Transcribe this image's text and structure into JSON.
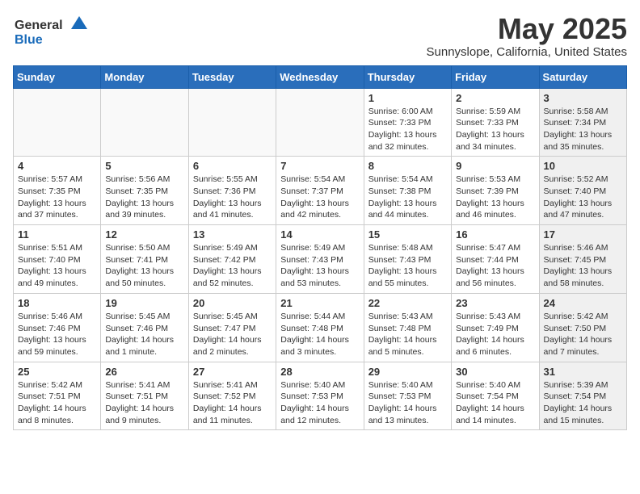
{
  "header": {
    "logo_general": "General",
    "logo_blue": "Blue",
    "month_year": "May 2025",
    "location": "Sunnyslope, California, United States"
  },
  "weekdays": [
    "Sunday",
    "Monday",
    "Tuesday",
    "Wednesday",
    "Thursday",
    "Friday",
    "Saturday"
  ],
  "weeks": [
    [
      {
        "day": "",
        "sunrise": "",
        "sunset": "",
        "daylight": "",
        "empty": true
      },
      {
        "day": "",
        "sunrise": "",
        "sunset": "",
        "daylight": "",
        "empty": true
      },
      {
        "day": "",
        "sunrise": "",
        "sunset": "",
        "daylight": "",
        "empty": true
      },
      {
        "day": "",
        "sunrise": "",
        "sunset": "",
        "daylight": "",
        "empty": true
      },
      {
        "day": "1",
        "sunrise": "Sunrise: 6:00 AM",
        "sunset": "Sunset: 7:33 PM",
        "daylight": "Daylight: 13 hours and 32 minutes."
      },
      {
        "day": "2",
        "sunrise": "Sunrise: 5:59 AM",
        "sunset": "Sunset: 7:33 PM",
        "daylight": "Daylight: 13 hours and 34 minutes."
      },
      {
        "day": "3",
        "sunrise": "Sunrise: 5:58 AM",
        "sunset": "Sunset: 7:34 PM",
        "daylight": "Daylight: 13 hours and 35 minutes.",
        "shaded": true
      }
    ],
    [
      {
        "day": "4",
        "sunrise": "Sunrise: 5:57 AM",
        "sunset": "Sunset: 7:35 PM",
        "daylight": "Daylight: 13 hours and 37 minutes."
      },
      {
        "day": "5",
        "sunrise": "Sunrise: 5:56 AM",
        "sunset": "Sunset: 7:35 PM",
        "daylight": "Daylight: 13 hours and 39 minutes."
      },
      {
        "day": "6",
        "sunrise": "Sunrise: 5:55 AM",
        "sunset": "Sunset: 7:36 PM",
        "daylight": "Daylight: 13 hours and 41 minutes."
      },
      {
        "day": "7",
        "sunrise": "Sunrise: 5:54 AM",
        "sunset": "Sunset: 7:37 PM",
        "daylight": "Daylight: 13 hours and 42 minutes."
      },
      {
        "day": "8",
        "sunrise": "Sunrise: 5:54 AM",
        "sunset": "Sunset: 7:38 PM",
        "daylight": "Daylight: 13 hours and 44 minutes."
      },
      {
        "day": "9",
        "sunrise": "Sunrise: 5:53 AM",
        "sunset": "Sunset: 7:39 PM",
        "daylight": "Daylight: 13 hours and 46 minutes."
      },
      {
        "day": "10",
        "sunrise": "Sunrise: 5:52 AM",
        "sunset": "Sunset: 7:40 PM",
        "daylight": "Daylight: 13 hours and 47 minutes.",
        "shaded": true
      }
    ],
    [
      {
        "day": "11",
        "sunrise": "Sunrise: 5:51 AM",
        "sunset": "Sunset: 7:40 PM",
        "daylight": "Daylight: 13 hours and 49 minutes."
      },
      {
        "day": "12",
        "sunrise": "Sunrise: 5:50 AM",
        "sunset": "Sunset: 7:41 PM",
        "daylight": "Daylight: 13 hours and 50 minutes."
      },
      {
        "day": "13",
        "sunrise": "Sunrise: 5:49 AM",
        "sunset": "Sunset: 7:42 PM",
        "daylight": "Daylight: 13 hours and 52 minutes."
      },
      {
        "day": "14",
        "sunrise": "Sunrise: 5:49 AM",
        "sunset": "Sunset: 7:43 PM",
        "daylight": "Daylight: 13 hours and 53 minutes."
      },
      {
        "day": "15",
        "sunrise": "Sunrise: 5:48 AM",
        "sunset": "Sunset: 7:43 PM",
        "daylight": "Daylight: 13 hours and 55 minutes."
      },
      {
        "day": "16",
        "sunrise": "Sunrise: 5:47 AM",
        "sunset": "Sunset: 7:44 PM",
        "daylight": "Daylight: 13 hours and 56 minutes."
      },
      {
        "day": "17",
        "sunrise": "Sunrise: 5:46 AM",
        "sunset": "Sunset: 7:45 PM",
        "daylight": "Daylight: 13 hours and 58 minutes.",
        "shaded": true
      }
    ],
    [
      {
        "day": "18",
        "sunrise": "Sunrise: 5:46 AM",
        "sunset": "Sunset: 7:46 PM",
        "daylight": "Daylight: 13 hours and 59 minutes."
      },
      {
        "day": "19",
        "sunrise": "Sunrise: 5:45 AM",
        "sunset": "Sunset: 7:46 PM",
        "daylight": "Daylight: 14 hours and 1 minute."
      },
      {
        "day": "20",
        "sunrise": "Sunrise: 5:45 AM",
        "sunset": "Sunset: 7:47 PM",
        "daylight": "Daylight: 14 hours and 2 minutes."
      },
      {
        "day": "21",
        "sunrise": "Sunrise: 5:44 AM",
        "sunset": "Sunset: 7:48 PM",
        "daylight": "Daylight: 14 hours and 3 minutes."
      },
      {
        "day": "22",
        "sunrise": "Sunrise: 5:43 AM",
        "sunset": "Sunset: 7:48 PM",
        "daylight": "Daylight: 14 hours and 5 minutes."
      },
      {
        "day": "23",
        "sunrise": "Sunrise: 5:43 AM",
        "sunset": "Sunset: 7:49 PM",
        "daylight": "Daylight: 14 hours and 6 minutes."
      },
      {
        "day": "24",
        "sunrise": "Sunrise: 5:42 AM",
        "sunset": "Sunset: 7:50 PM",
        "daylight": "Daylight: 14 hours and 7 minutes.",
        "shaded": true
      }
    ],
    [
      {
        "day": "25",
        "sunrise": "Sunrise: 5:42 AM",
        "sunset": "Sunset: 7:51 PM",
        "daylight": "Daylight: 14 hours and 8 minutes."
      },
      {
        "day": "26",
        "sunrise": "Sunrise: 5:41 AM",
        "sunset": "Sunset: 7:51 PM",
        "daylight": "Daylight: 14 hours and 9 minutes."
      },
      {
        "day": "27",
        "sunrise": "Sunrise: 5:41 AM",
        "sunset": "Sunset: 7:52 PM",
        "daylight": "Daylight: 14 hours and 11 minutes."
      },
      {
        "day": "28",
        "sunrise": "Sunrise: 5:40 AM",
        "sunset": "Sunset: 7:53 PM",
        "daylight": "Daylight: 14 hours and 12 minutes."
      },
      {
        "day": "29",
        "sunrise": "Sunrise: 5:40 AM",
        "sunset": "Sunset: 7:53 PM",
        "daylight": "Daylight: 14 hours and 13 minutes."
      },
      {
        "day": "30",
        "sunrise": "Sunrise: 5:40 AM",
        "sunset": "Sunset: 7:54 PM",
        "daylight": "Daylight: 14 hours and 14 minutes."
      },
      {
        "day": "31",
        "sunrise": "Sunrise: 5:39 AM",
        "sunset": "Sunset: 7:54 PM",
        "daylight": "Daylight: 14 hours and 15 minutes.",
        "shaded": true
      }
    ]
  ]
}
